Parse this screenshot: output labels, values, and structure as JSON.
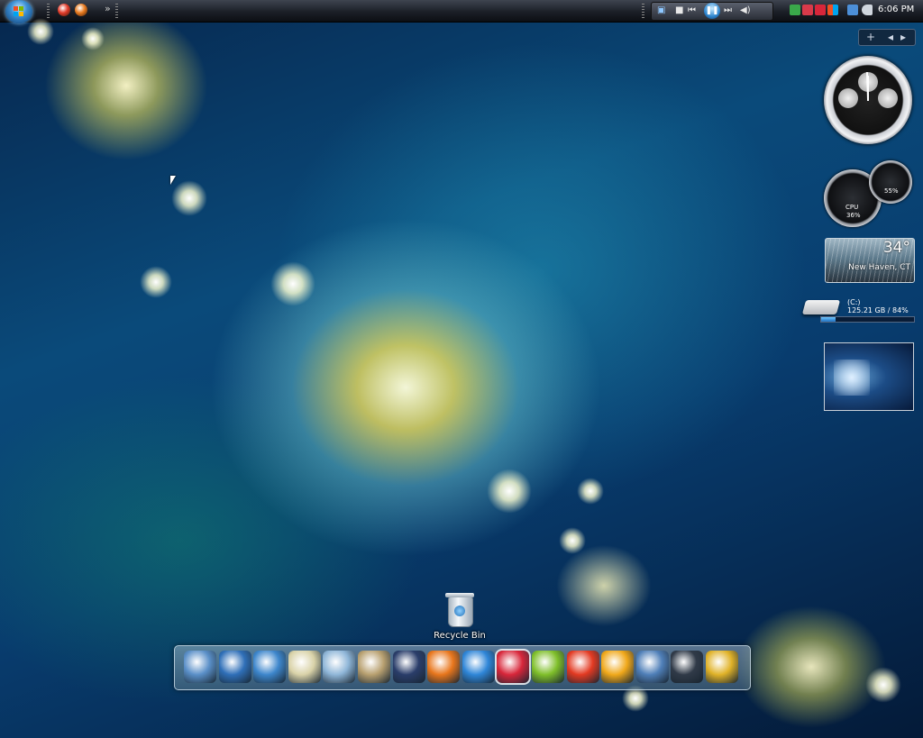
{
  "taskbar": {
    "quick_launch": [
      {
        "icon": "opera-icon",
        "color": "#e23b2a"
      },
      {
        "icon": "firefox-icon",
        "color": "#e87a1e"
      }
    ],
    "overflow_label": "»",
    "media_player": {
      "stop_label": "■",
      "prev_label": "⏮",
      "play_label": "❚❚",
      "next_label": "⏭",
      "volume_label": "◀)"
    },
    "clock": "6:06 PM"
  },
  "sidebar": {
    "add_label": "+",
    "prev_label": "◂",
    "next_label": "▸",
    "cpu_meter": {
      "cpu_label": "CPU",
      "cpu_value": "36%",
      "mem_value": "55%"
    },
    "weather": {
      "temperature": "34°",
      "city": "New Haven, CT"
    },
    "drive": {
      "label": "(C:)",
      "size": "125.21 GB / 84%",
      "used_fraction": 0.16
    }
  },
  "desktop": {
    "recycle_bin_label": "Recycle Bin"
  },
  "dock": {
    "items": [
      {
        "icon": "computer-icon",
        "color": "#5a8fc8"
      },
      {
        "icon": "monitor-icon",
        "color": "#2f6fb8"
      },
      {
        "icon": "network-icon",
        "color": "#3d86cc"
      },
      {
        "icon": "documents-icon",
        "color": "#d9d2a8"
      },
      {
        "icon": "music-icon",
        "color": "#8fb6d8"
      },
      {
        "icon": "pictures-icon",
        "color": "#b8a070"
      },
      {
        "icon": "counter-strike-icon",
        "color": "#2a3d6a"
      },
      {
        "icon": "firefox-icon",
        "color": "#e8761c"
      },
      {
        "icon": "internet-explorer-icon",
        "color": "#2f86d8"
      },
      {
        "icon": "mcafee-icon",
        "color": "#d8263a"
      },
      {
        "icon": "limewire-icon",
        "color": "#7fbf2a"
      },
      {
        "icon": "opera-icon",
        "color": "#e33a22"
      },
      {
        "icon": "messenger-icon",
        "color": "#f0a81a"
      },
      {
        "icon": "photo-icon",
        "color": "#4f7fb8"
      },
      {
        "icon": "media-player-classic-icon",
        "color": "#303a48"
      },
      {
        "icon": "tools-icon",
        "color": "#e0b228"
      }
    ]
  }
}
